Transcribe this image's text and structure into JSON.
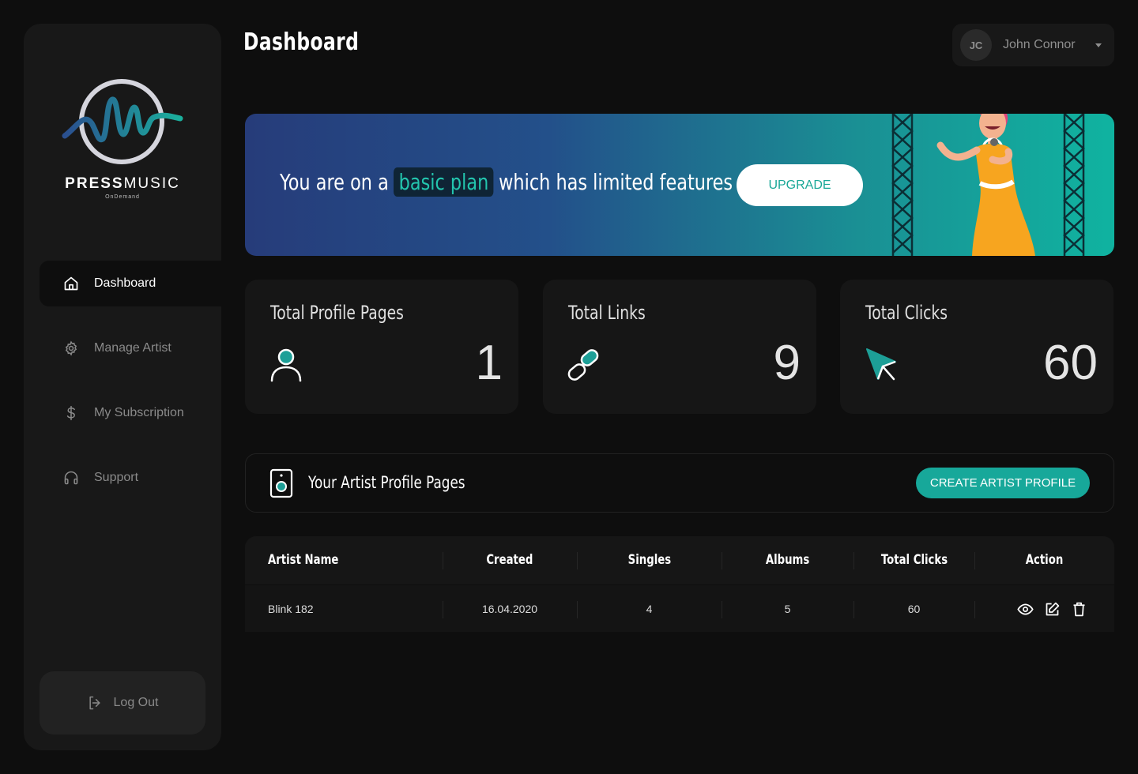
{
  "brand": {
    "name_bold": "PRESS",
    "name_light": "MUSIC",
    "tagline": "OnDemand"
  },
  "sidebar": {
    "items": [
      {
        "label": "Dashboard",
        "icon": "home-icon",
        "active": true
      },
      {
        "label": "Manage Artist",
        "icon": "gear-icon",
        "active": false
      },
      {
        "label": "My Subscription",
        "icon": "dollar-icon",
        "active": false
      },
      {
        "label": "Support",
        "icon": "headphones-icon",
        "active": false
      }
    ],
    "logout_label": "Log Out"
  },
  "header": {
    "title": "Dashboard",
    "user": {
      "initials": "JC",
      "name": "John Connor"
    }
  },
  "banner": {
    "text_before": "You are on a",
    "plan": "basic plan",
    "text_after": "which has limited features",
    "button_label": "UPGRADE"
  },
  "stats": [
    {
      "title": "Total Profile Pages",
      "value": "1",
      "icon": "user-icon"
    },
    {
      "title": "Total Links",
      "value": "9",
      "icon": "link-icon"
    },
    {
      "title": "Total Clicks",
      "value": "60",
      "icon": "cursor-icon"
    }
  ],
  "profiles": {
    "title": "Your Artist Profile Pages",
    "create_label": "CREATE ARTIST PROFILE",
    "columns": [
      "Artist Name",
      "Created",
      "Singles",
      "Albums",
      "Total Clicks",
      "Action"
    ],
    "rows": [
      {
        "artist": "Blink 182",
        "created": "16.04.2020",
        "singles": "4",
        "albums": "5",
        "clicks": "60"
      }
    ]
  },
  "colors": {
    "accent": "#17a89a",
    "background": "#0e0e0e",
    "card": "#161616",
    "sidebar": "#181818"
  }
}
